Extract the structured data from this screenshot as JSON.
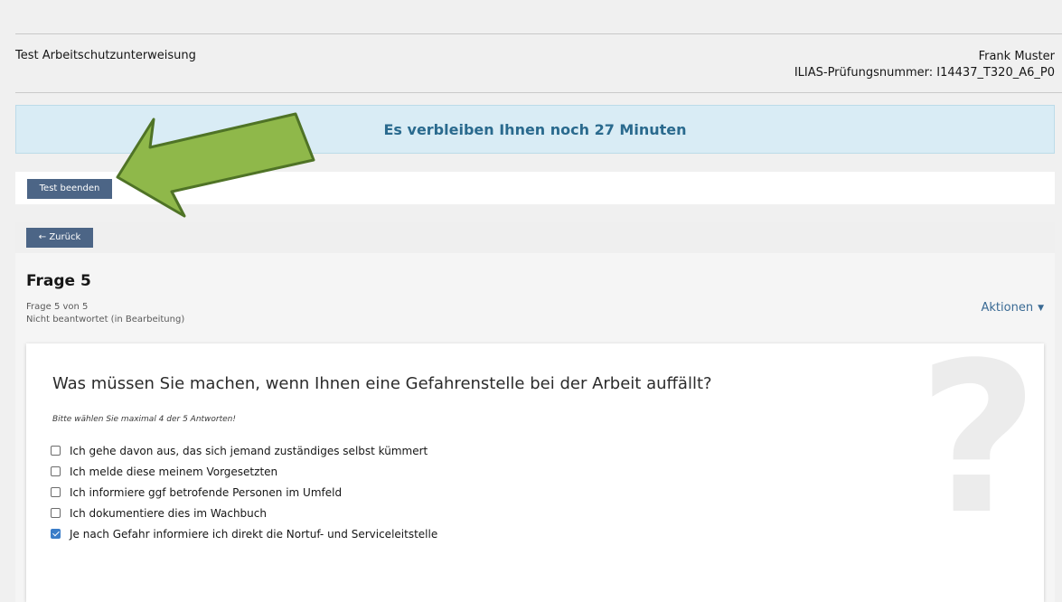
{
  "header": {
    "test_title": "Test Arbeitschutzunterweisung",
    "user_name": "Frank Muster",
    "exam_number": "ILIAS-Prüfungsnummer: I14437_T320_A6_P0"
  },
  "timer": {
    "text": "Es verbleiben Ihnen noch 27 Minuten"
  },
  "toolbar": {
    "finish_label": "Test beenden"
  },
  "navigation": {
    "back_label": "Zurück"
  },
  "question": {
    "title": "Frage 5",
    "position": "Frage 5 von 5",
    "status": "Nicht beantwortet (in Bearbeitung)",
    "actions_label": "Aktionen",
    "text": "Was müssen Sie machen, wenn Ihnen eine Gefahrenstelle bei der Arbeit auffällt?",
    "hint": "Bitte wählen Sie maximal 4 der 5 Antworten!",
    "answers": [
      {
        "label": "Ich gehe davon aus, das sich jemand zuständiges selbst kümmert",
        "checked": false
      },
      {
        "label": "Ich melde diese meinem Vorgesetzten",
        "checked": false
      },
      {
        "label": "Ich informiere ggf betrofende Personen im Umfeld",
        "checked": false
      },
      {
        "label": "Ich dokumentiere dies im Wachbuch",
        "checked": false
      },
      {
        "label": "Je nach Gefahr informiere ich direkt die Nortuf- und Serviceleitstelle",
        "checked": true
      }
    ]
  },
  "colors": {
    "accent": "#4c6586",
    "timer_bg": "#d9ecf5",
    "timer_text": "#2a6a8e",
    "arrow_fill": "#8fb84a",
    "checkbox_checked": "#3a7dc8"
  },
  "icons": {
    "back": "arrow-left-icon",
    "actions": "caret-down-icon",
    "question_watermark": "question-mark-icon",
    "annotation": "arrow-annotation"
  }
}
